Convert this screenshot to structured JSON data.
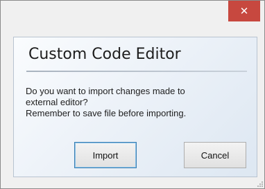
{
  "window": {
    "close_glyph": "✕"
  },
  "dialog": {
    "title": "Custom Code Editor",
    "message_line1": "Do you want to import changes made to",
    "message_line2": "external editor?",
    "message_line3": "Remember to save file before importing."
  },
  "buttons": {
    "import_label": "Import",
    "cancel_label": "Cancel"
  },
  "colors": {
    "close_button": "#c7483f",
    "primary_border": "#3c7fb1"
  },
  "icons": [
    "close-icon",
    "resize-grip-icon"
  ]
}
